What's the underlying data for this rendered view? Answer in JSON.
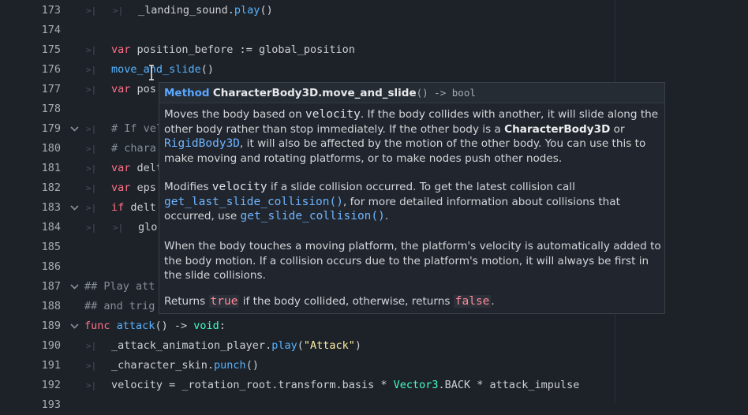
{
  "editor": {
    "lines": [
      {
        "num": "173",
        "tokens": [
          {
            "c": "tx",
            "t": "_landing_sound."
          },
          {
            "c": "fn",
            "t": "play"
          },
          {
            "c": "tx",
            "t": "()"
          }
        ]
      },
      {
        "num": "174",
        "tokens": []
      },
      {
        "num": "175",
        "tokens": [
          {
            "c": "kw",
            "t": "var"
          },
          {
            "c": "tx",
            "t": " position_before := global_position"
          }
        ]
      },
      {
        "num": "176",
        "tokens": [
          {
            "c": "fn",
            "t": "move_and_slide"
          },
          {
            "c": "tx",
            "t": "()"
          }
        ]
      },
      {
        "num": "177",
        "tokens": [
          {
            "c": "kw",
            "t": "var"
          },
          {
            "c": "tx",
            "t": " pos"
          }
        ]
      },
      {
        "num": "178",
        "tokens": []
      },
      {
        "num": "179",
        "tokens": [
          {
            "c": "cm",
            "t": "# If vel"
          }
        ]
      },
      {
        "num": "180",
        "tokens": [
          {
            "c": "cm",
            "t": "# chara"
          }
        ]
      },
      {
        "num": "181",
        "tokens": [
          {
            "c": "kw",
            "t": "var"
          },
          {
            "c": "tx",
            "t": " delt"
          }
        ]
      },
      {
        "num": "182",
        "tokens": [
          {
            "c": "kw",
            "t": "var"
          },
          {
            "c": "tx",
            "t": " eps"
          }
        ]
      },
      {
        "num": "183",
        "tokens": [
          {
            "c": "kw",
            "t": "if"
          },
          {
            "c": "tx",
            "t": " delt"
          }
        ]
      },
      {
        "num": "184",
        "tokens": [
          {
            "c": "tx",
            "t": "glo"
          }
        ]
      },
      {
        "num": "185",
        "tokens": []
      },
      {
        "num": "186",
        "tokens": []
      },
      {
        "num": "187",
        "tokens": [
          {
            "c": "cm",
            "t": "## Play att"
          }
        ]
      },
      {
        "num": "188",
        "tokens": [
          {
            "c": "cm",
            "t": "## and trig"
          }
        ]
      },
      {
        "num": "189",
        "tokens": [
          {
            "c": "kw",
            "t": "func"
          },
          {
            "c": "tx",
            "t": " "
          },
          {
            "c": "fn",
            "t": "attack"
          },
          {
            "c": "tx",
            "t": "() -> "
          },
          {
            "c": "ty",
            "t": "void"
          },
          {
            "c": "tx",
            "t": ":"
          }
        ]
      },
      {
        "num": "190",
        "tokens": [
          {
            "c": "tx",
            "t": "_attack_animation_player."
          },
          {
            "c": "fn",
            "t": "play"
          },
          {
            "c": "tx",
            "t": "("
          },
          {
            "c": "str",
            "t": "\"Attack\""
          },
          {
            "c": "tx",
            "t": ")"
          }
        ]
      },
      {
        "num": "191",
        "tokens": [
          {
            "c": "tx",
            "t": "_character_skin."
          },
          {
            "c": "fn",
            "t": "punch"
          },
          {
            "c": "tx",
            "t": "()"
          }
        ]
      },
      {
        "num": "192",
        "tokens": [
          {
            "c": "tx",
            "t": "velocity = _rotation_root.transform.basis * "
          },
          {
            "c": "ty",
            "t": "Vector3"
          },
          {
            "c": "tx",
            "t": ".BACK * attack_impulse"
          }
        ]
      },
      {
        "num": "193",
        "tokens": []
      }
    ]
  },
  "tooltip": {
    "kind": "Method",
    "signature": "CharacterBody3D.move_and_slide",
    "rest": "() -> bool",
    "p1": {
      "a": "Moves the body based on ",
      "velocity": "velocity",
      "b": ". If the body collides with another, it will slide along the other body rather than stop immediately. If the other body is a ",
      "cb3d": "CharacterBody3D",
      "c": " or ",
      "rb3d": "RigidBody3D",
      "d": ", it will also be affected by the motion of the other body. You can use this to make moving and rotating platforms, or to make nodes push other nodes."
    },
    "p2": {
      "a": "Modifies ",
      "velocity": "velocity",
      "b": " if a slide collision occurred. To get the latest collision call ",
      "link1": "get_last_slide_collision()",
      "c": ", for more detailed information about collisions that occurred, use ",
      "link2": "get_slide_collision()",
      "d": "."
    },
    "p3": "When the body touches a moving platform, the platform's velocity is automatically added to the body motion. If a collision occurs due to the platform's motion, it will always be first in the slide collisions.",
    "p4": {
      "a": "Returns ",
      "true": "true",
      "b": " if the body collided, otherwise, returns ",
      "false": "false",
      "c": "."
    }
  },
  "colors": {
    "background": "#1d2229",
    "keyword": "#ff7085",
    "function": "#57b3ff",
    "type": "#42ffc2",
    "string": "#ffeda1",
    "comment": "#858d96"
  }
}
